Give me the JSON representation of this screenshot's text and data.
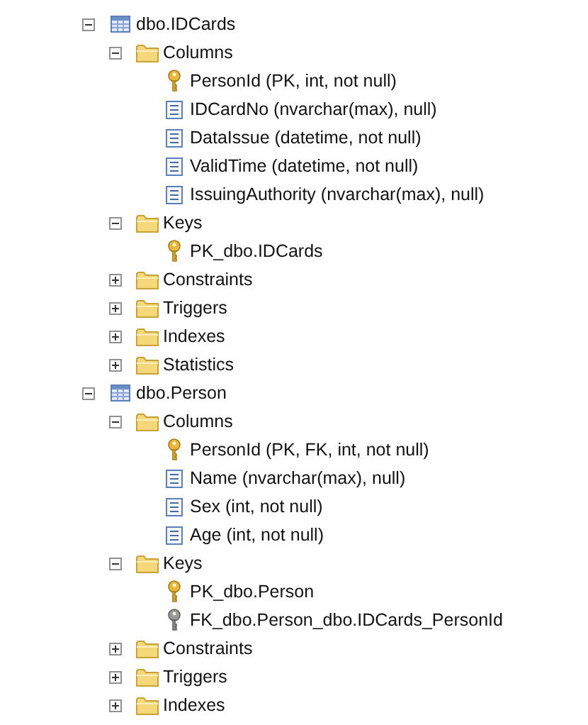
{
  "tree": [
    {
      "label": "dbo.IDCards",
      "kind": "table",
      "expanded": true,
      "children": [
        {
          "label": "Columns",
          "kind": "folder",
          "expanded": true,
          "children": [
            {
              "label": "PersonId (PK, int, not null)",
              "kind": "pk"
            },
            {
              "label": "IDCardNo (nvarchar(max), null)",
              "kind": "column"
            },
            {
              "label": "DataIssue (datetime, not null)",
              "kind": "column"
            },
            {
              "label": "ValidTime (datetime, not null)",
              "kind": "column"
            },
            {
              "label": "IssuingAuthority (nvarchar(max), null)",
              "kind": "column"
            }
          ]
        },
        {
          "label": "Keys",
          "kind": "folder",
          "expanded": true,
          "children": [
            {
              "label": "PK_dbo.IDCards",
              "kind": "pk"
            }
          ]
        },
        {
          "label": "Constraints",
          "kind": "folder",
          "expanded": false
        },
        {
          "label": "Triggers",
          "kind": "folder",
          "expanded": false
        },
        {
          "label": "Indexes",
          "kind": "folder",
          "expanded": false
        },
        {
          "label": "Statistics",
          "kind": "folder",
          "expanded": false
        }
      ]
    },
    {
      "label": "dbo.Person",
      "kind": "table",
      "expanded": true,
      "children": [
        {
          "label": "Columns",
          "kind": "folder",
          "expanded": true,
          "children": [
            {
              "label": "PersonId (PK, FK, int, not null)",
              "kind": "pk"
            },
            {
              "label": "Name (nvarchar(max), null)",
              "kind": "column"
            },
            {
              "label": "Sex (int, not null)",
              "kind": "column"
            },
            {
              "label": "Age (int, not null)",
              "kind": "column"
            }
          ]
        },
        {
          "label": "Keys",
          "kind": "folder",
          "expanded": true,
          "children": [
            {
              "label": "PK_dbo.Person",
              "kind": "pk"
            },
            {
              "label": "FK_dbo.Person_dbo.IDCards_PersonId",
              "kind": "fk"
            }
          ]
        },
        {
          "label": "Constraints",
          "kind": "folder",
          "expanded": false
        },
        {
          "label": "Triggers",
          "kind": "folder",
          "expanded": false
        },
        {
          "label": "Indexes",
          "kind": "folder",
          "expanded": false
        }
      ]
    }
  ]
}
